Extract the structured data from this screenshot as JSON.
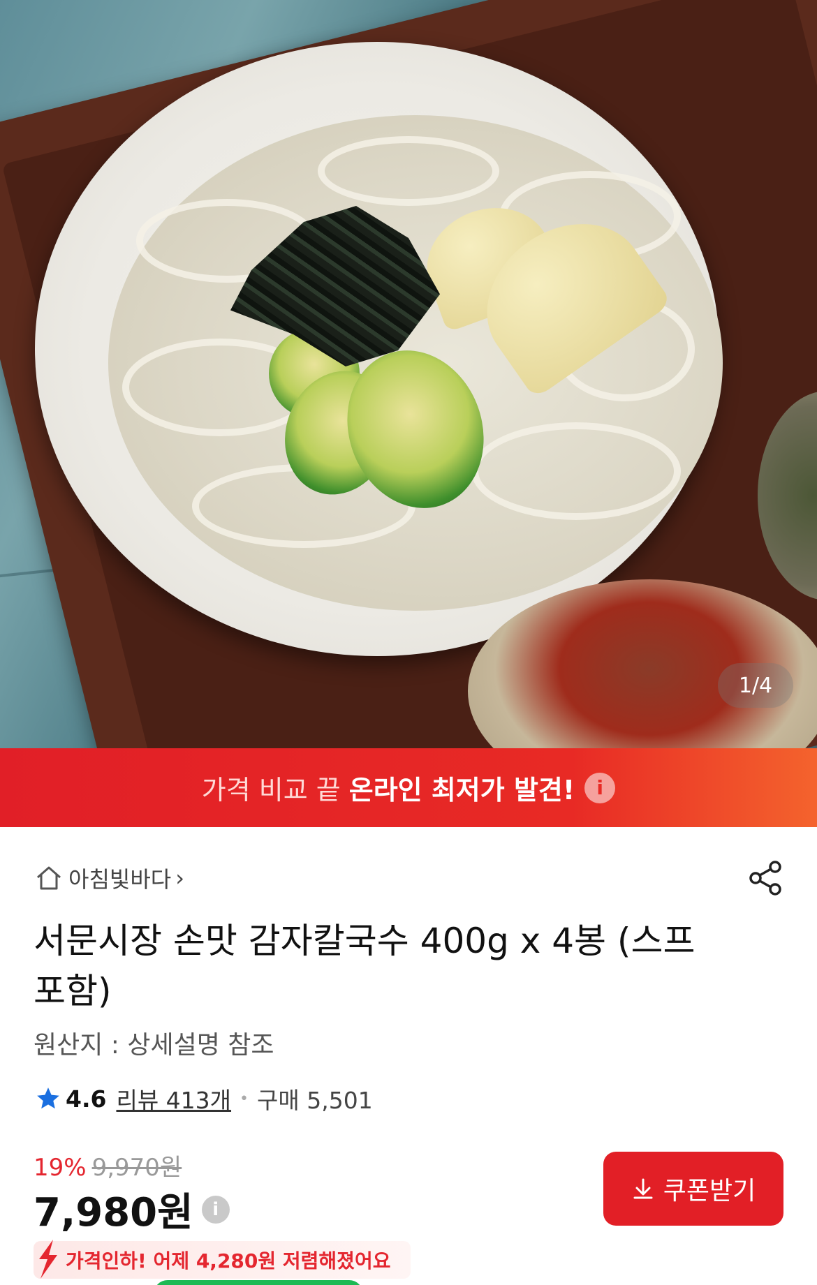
{
  "gallery": {
    "counter": "1/4"
  },
  "banner": {
    "prefix": "가격 비교 끝",
    "highlight": "온라인 최저가 발견!",
    "info_icon": "info-icon",
    "color": "#e82a25"
  },
  "product": {
    "store_name": "아침빛바다",
    "title": "서문시장 손맛 감자칼국수 400g x 4봉 (스프포함)",
    "origin": "원산지 : 상세설명 참조",
    "rating": "4.6",
    "reviews": "리뷰 413개",
    "purchases": "구매 5,501",
    "discount_pct": "19%",
    "original_price": "9,970원",
    "price": "7,980원",
    "coupon_label": "쿠폰받기",
    "price_drop_text": "가격인하! 어제 4,280원 저렴해졌어요"
  },
  "colors": {
    "accent_red": "#e21f26",
    "star_blue": "#1a6fe0"
  }
}
